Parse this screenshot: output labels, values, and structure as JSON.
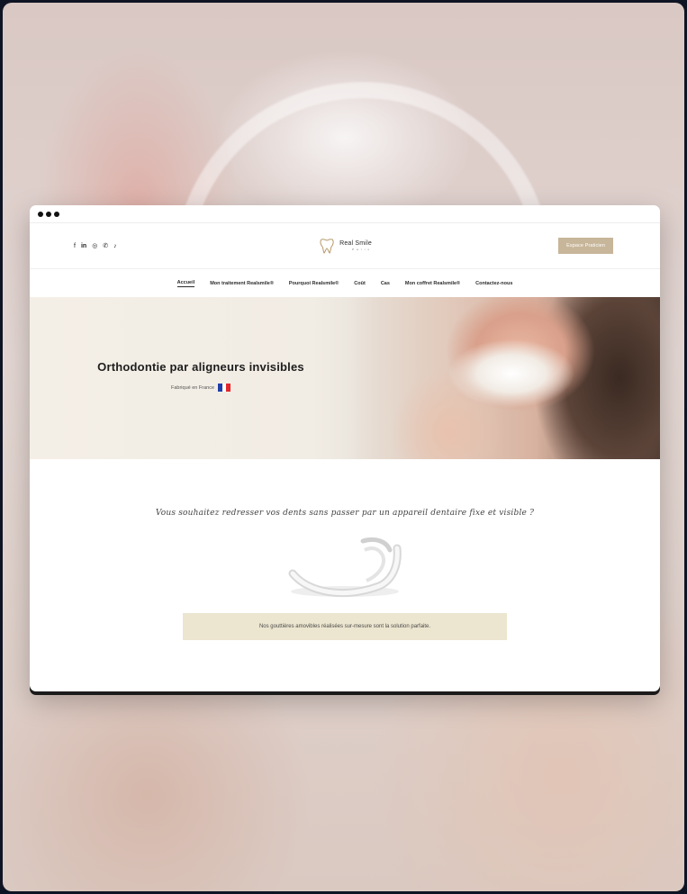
{
  "colors": {
    "accent": "#c8b69a",
    "cta_background": "#ece5cf",
    "page_background": "#0e1424"
  },
  "browser": {
    "dots": [
      "dot",
      "dot",
      "dot"
    ]
  },
  "header": {
    "social_icons": [
      "facebook-icon",
      "linkedin-icon",
      "instagram-icon",
      "whatsapp-icon",
      "tiktok-icon"
    ],
    "social_glyphs": [
      "f",
      "in",
      "◎",
      "✆",
      "♪"
    ],
    "brand_name": "Real Smile",
    "brand_sub": "Paris",
    "pro_button_label": "Espace Praticien"
  },
  "nav": {
    "items": [
      {
        "label": "Accueil",
        "active": true
      },
      {
        "label": "Mon traitement Realsmile®",
        "active": false
      },
      {
        "label": "Pourquoi Realsmile®",
        "active": false
      },
      {
        "label": "Coût",
        "active": false
      },
      {
        "label": "Cas",
        "active": false
      },
      {
        "label": "Mon coffret Realsmile®",
        "active": false
      },
      {
        "label": "Contactez-nous",
        "active": false
      }
    ]
  },
  "hero": {
    "title": "Orthodontie par aligneurs invisibles",
    "subtitle": "Fabriqué en France",
    "flag_icon": "french-flag-icon"
  },
  "content": {
    "tagline": "Vous souhaitez redresser vos dents sans passer par un appareil dentaire fixe et visible ?",
    "cta_text": "Nos gouttières amovibles réalisées sur-mesure sont la solution parfaite."
  }
}
